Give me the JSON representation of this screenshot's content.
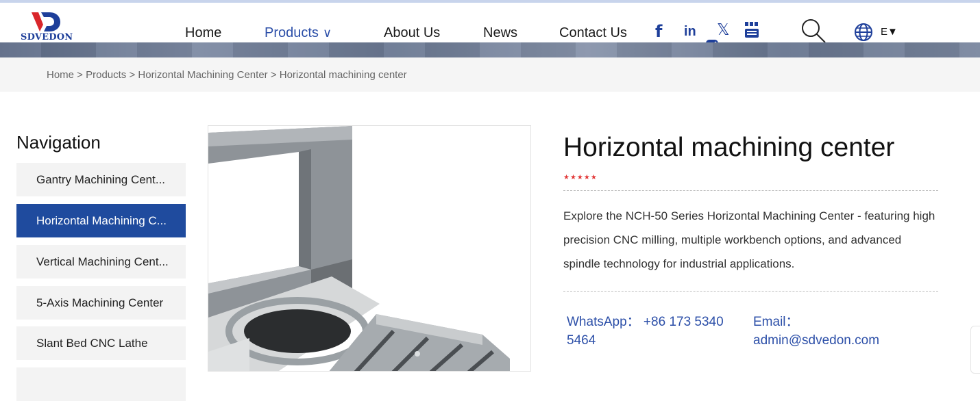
{
  "header": {
    "logo_text": "SDVEDON",
    "nav": [
      {
        "label": "Home"
      },
      {
        "label": "Products"
      },
      {
        "label": "About Us"
      },
      {
        "label": "News"
      },
      {
        "label": "Contact Us"
      }
    ],
    "products_chevron": "∨",
    "social": {
      "facebook": "f",
      "linkedin": "in",
      "x": "𝕏"
    },
    "language_label": "E▼",
    "colors": {
      "brand_blue": "#1e3f9a",
      "active_nav": "#2c4fa8",
      "youtube_icon": "#1e3f9a",
      "instagram_badge": "#1e3f9a"
    }
  },
  "breadcrumb": "Home > Products > Horizontal Machining Center > Horizontal machining center",
  "sidebar": {
    "title": "Navigation",
    "items": [
      {
        "label": "Gantry Machining Cent..."
      },
      {
        "label": "Horizontal Machining C..."
      },
      {
        "label": "Vertical Machining Cent..."
      },
      {
        "label": "5-Axis Machining Center"
      },
      {
        "label": "Slant Bed CNC Lathe"
      }
    ],
    "active_index": 1,
    "active_color": "#1f4b9e"
  },
  "product": {
    "title": "Horizontal machining center",
    "stars": "★★★★★",
    "rating": 5,
    "description": "Explore the NCH-50 Series Horizontal Machining Center - featuring high precision CNC milling, multiple workbench options, and advanced spindle technology for industrial applications.",
    "whatsapp": "WhatsApp： +86 173 5340 5464",
    "email": "Email： admin@sdvedon.com",
    "star_color": "#e23838"
  }
}
